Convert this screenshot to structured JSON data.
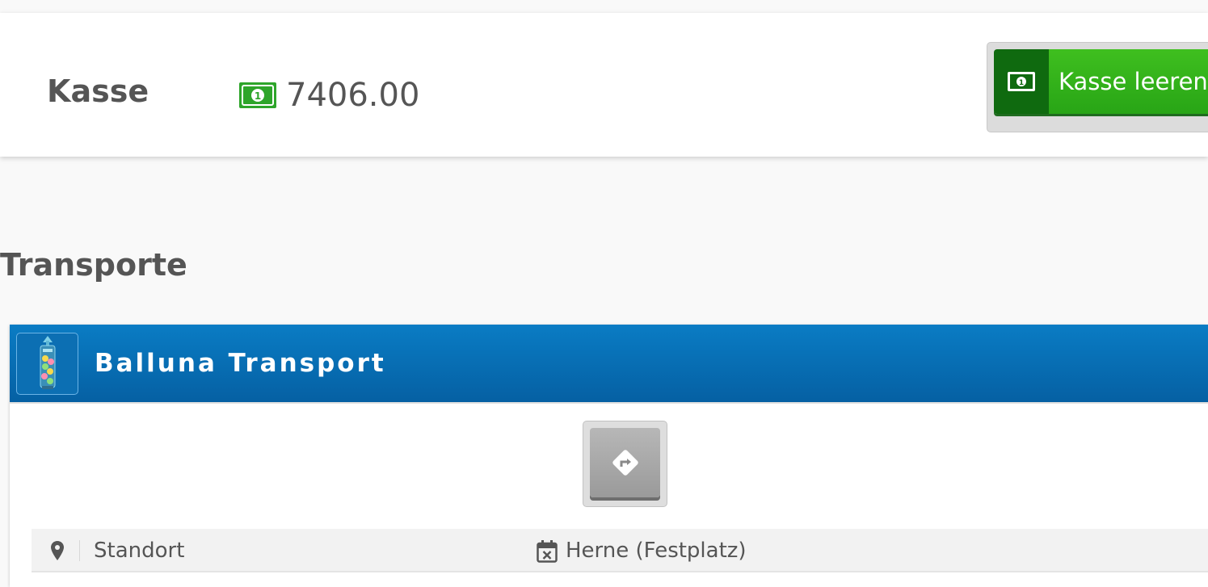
{
  "cash": {
    "title": "Kasse",
    "amount": "7406.00",
    "empty_button_label": "Kasse leeren"
  },
  "transports": {
    "heading": "Transporte",
    "cards": [
      {
        "title": "Balluna Transport",
        "info": {
          "label": "Standort",
          "value": "Herne (Festplatz)"
        }
      }
    ]
  },
  "colors": {
    "money_green": "#2ea52a",
    "button_green": "#28a516",
    "button_dark_green": "#0f6a0f",
    "header_blue": "#0560a3"
  },
  "icons": {
    "cash": "money-bill-icon",
    "route": "route-diamond-icon",
    "location": "map-pin-icon",
    "calendar": "calendar-x-icon"
  }
}
